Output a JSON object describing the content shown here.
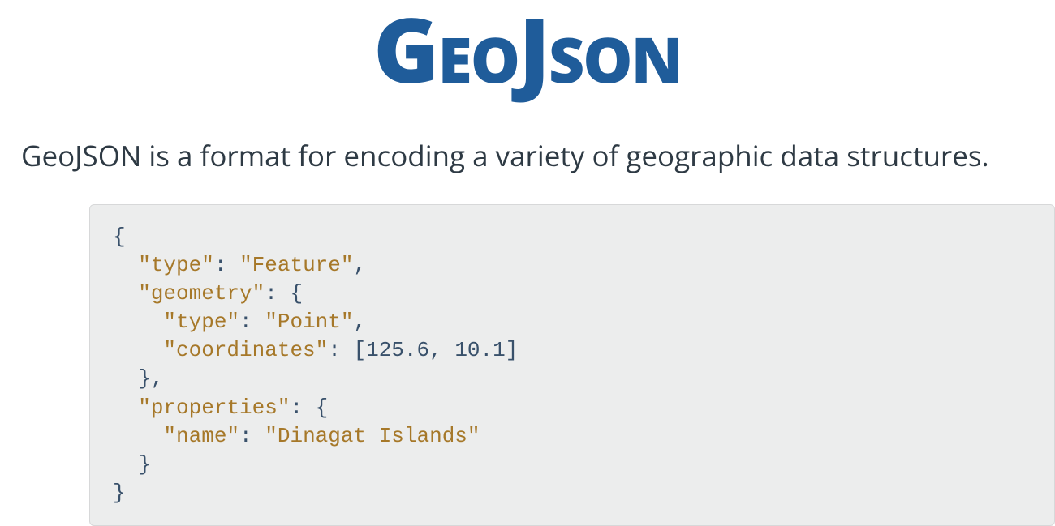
{
  "title": "GeoJson",
  "description": "GeoJSON is a format for encoding a variety of geographic data structures.",
  "code": {
    "line1_open": "{",
    "key_type": "\"type\"",
    "val_feature": "\"Feature\"",
    "key_geometry": "\"geometry\"",
    "val_open": "{",
    "key_type2": "\"type\"",
    "val_point": "\"Point\"",
    "key_coordinates": "\"coordinates\"",
    "coord_open": "[",
    "coord1": "125.6",
    "coord_sep": ", ",
    "coord2": "10.1",
    "coord_close": "]",
    "geom_close": "},",
    "key_properties": "\"properties\"",
    "key_name": "\"name\"",
    "val_name": "\"Dinagat Islands\"",
    "props_close": "}",
    "line_close": "}",
    "colon": ": ",
    "comma": ","
  }
}
